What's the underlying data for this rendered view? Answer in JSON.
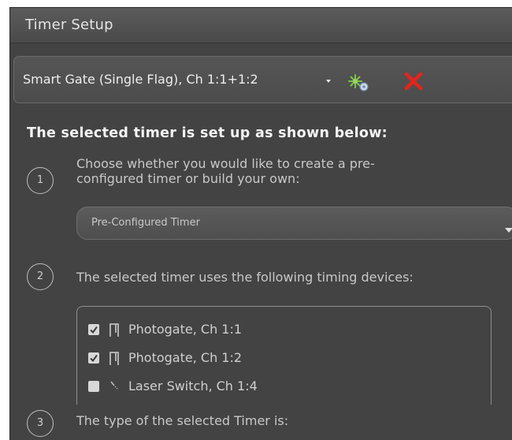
{
  "window": {
    "title": "Timer Setup"
  },
  "timer_bar": {
    "name": "Smart Gate (Single Flag), Ch 1:1+1:2",
    "setup_icon": "gear-star-icon",
    "delete_icon": "red-x-icon",
    "delete_color": "#e8231c"
  },
  "heading": "The selected timer is set up as shown below:",
  "steps": [
    {
      "number": "1",
      "text_line1": "Choose whether you would like to create a pre-",
      "text_line2": "configured timer or build your own:"
    },
    {
      "number": "2",
      "text": "The selected timer uses the following timing devices:"
    },
    {
      "number": "3",
      "text": "The type of the selected Timer is:"
    }
  ],
  "timer_kind_select": {
    "value": "Pre-Configured Timer"
  },
  "devices": [
    {
      "label": "Photogate, Ch 1:1",
      "checked": true,
      "icon": "photogate-icon"
    },
    {
      "label": "Photogate, Ch 1:2",
      "checked": true,
      "icon": "photogate-icon"
    },
    {
      "label": "Laser Switch, Ch 1:4",
      "checked": false,
      "icon": "laser-switch-icon"
    }
  ]
}
